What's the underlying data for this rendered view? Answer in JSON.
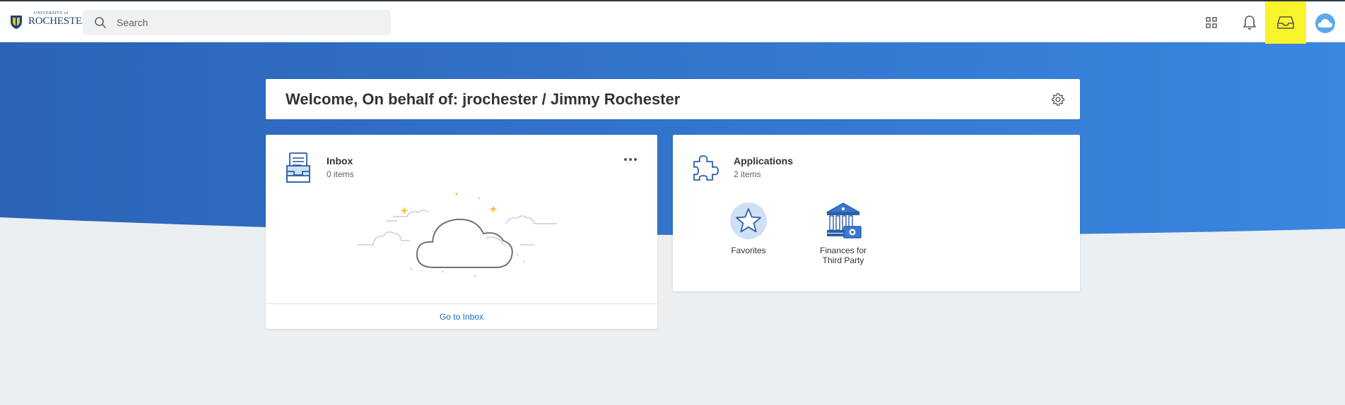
{
  "header": {
    "logo": {
      "small_text": "UNIVERSITY of",
      "main_text": "ROCHESTER"
    },
    "search": {
      "placeholder": "Search",
      "value": ""
    },
    "icons": [
      "apps-grid-icon",
      "notifications-bell-icon",
      "inbox-tray-icon",
      "profile-cloud-avatar"
    ],
    "highlight_color": "#f8f32b"
  },
  "welcome": {
    "title": "Welcome, On behalf of: jrochester / Jimmy Rochester"
  },
  "inbox_card": {
    "title": "Inbox",
    "count": "0 items",
    "link": "Go to Inbox"
  },
  "applications_card": {
    "title": "Applications",
    "count": "2 items",
    "apps": [
      {
        "label": "Favorites",
        "icon": "star-icon"
      },
      {
        "label": "Finances for Third Party",
        "icon": "bank-money-icon"
      }
    ]
  },
  "colors": {
    "hero_blue": "#2f6fc6",
    "link_blue": "#1c6bb7",
    "background": "#eceff1"
  }
}
